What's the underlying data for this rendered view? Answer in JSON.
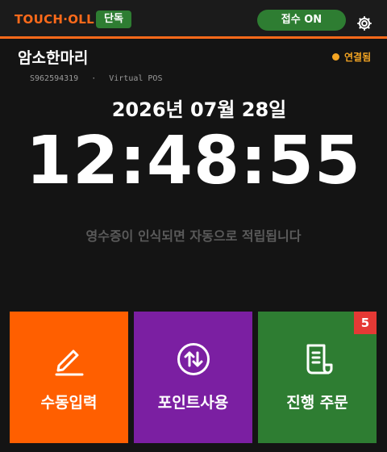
{
  "header": {
    "brand": "TOUCH·OLL",
    "mode_badge": "단독",
    "accept_toggle": "접수 ON",
    "settings_icon": "gear-icon"
  },
  "store": {
    "name": "암소한마리",
    "connection_status": "연결됨",
    "device_id": "S962594319",
    "separator": "·",
    "pos_type": "Virtual POS"
  },
  "clock": {
    "date": "2026년 07월 28일",
    "time": "12:48:55"
  },
  "hint": "영수증이 인식되면 자동으로 적립됩니다",
  "actions": {
    "manual_entry": {
      "label": "수동입력",
      "icon": "pencil-icon"
    },
    "use_points": {
      "label": "포인트사용",
      "icon": "exchange-arrows-icon"
    },
    "pending_orders": {
      "label": "진행 주문",
      "icon": "receipt-icon",
      "count": "5"
    }
  },
  "colors": {
    "accent": "#ff6a1a",
    "status_green": "#2e7d32",
    "connected": "#f5a623",
    "manual_tile": "#ff5f00",
    "points_tile": "#7b1fa2",
    "orders_tile": "#2e7d32",
    "badge_red": "#e53935"
  }
}
